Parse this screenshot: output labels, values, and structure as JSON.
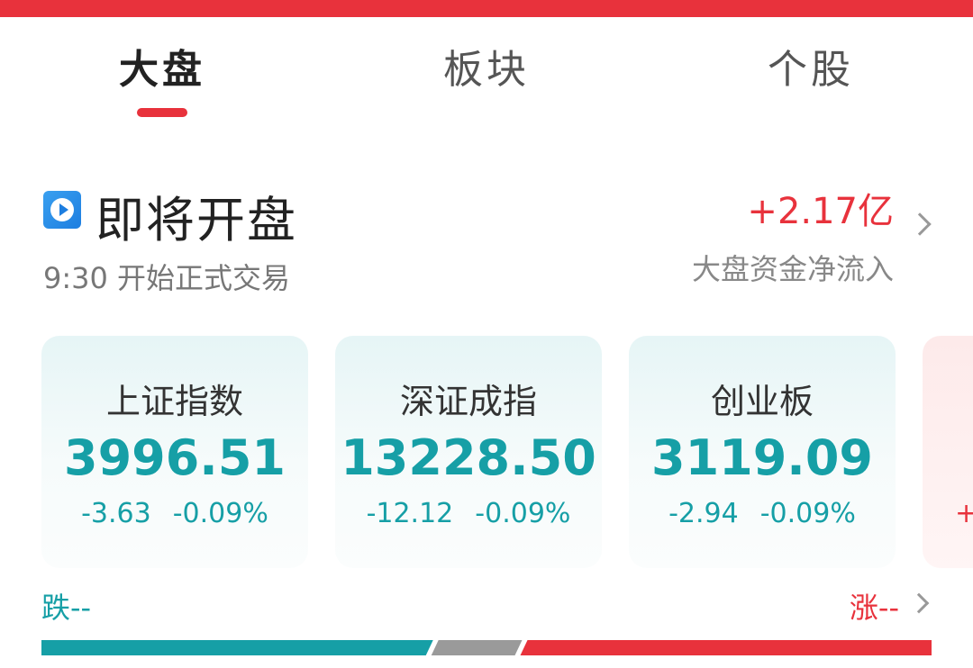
{
  "tabs": [
    {
      "label": "大盘",
      "active": true
    },
    {
      "label": "板块",
      "active": false
    },
    {
      "label": "个股",
      "active": false
    }
  ],
  "status": {
    "icon": "play-circle-icon",
    "title": "即将开盘",
    "subtitle": "9:30 开始正式交易",
    "flow_value": "+2.17亿",
    "flow_label": "大盘资金净流入"
  },
  "indices": [
    {
      "name": "上证指数",
      "value": "3996.51",
      "change": "-3.63",
      "pct": "-0.09%"
    },
    {
      "name": "深证成指",
      "value": "13228.50",
      "change": "-12.12",
      "pct": "-0.09%"
    },
    {
      "name": "创业板",
      "value": "3119.09",
      "change": "-2.94",
      "pct": "-0.09%"
    }
  ],
  "partial_card": {
    "change_prefix": "+"
  },
  "breadth": {
    "fall_label": "跌--",
    "rise_label": "涨--",
    "fall_fraction": 0.44,
    "flat_fraction": 0.1,
    "rise_fraction": 0.46
  },
  "colors": {
    "accent_red": "#e8323c",
    "fall_teal": "#169fa6",
    "flat_gray": "#9a9a9a"
  }
}
